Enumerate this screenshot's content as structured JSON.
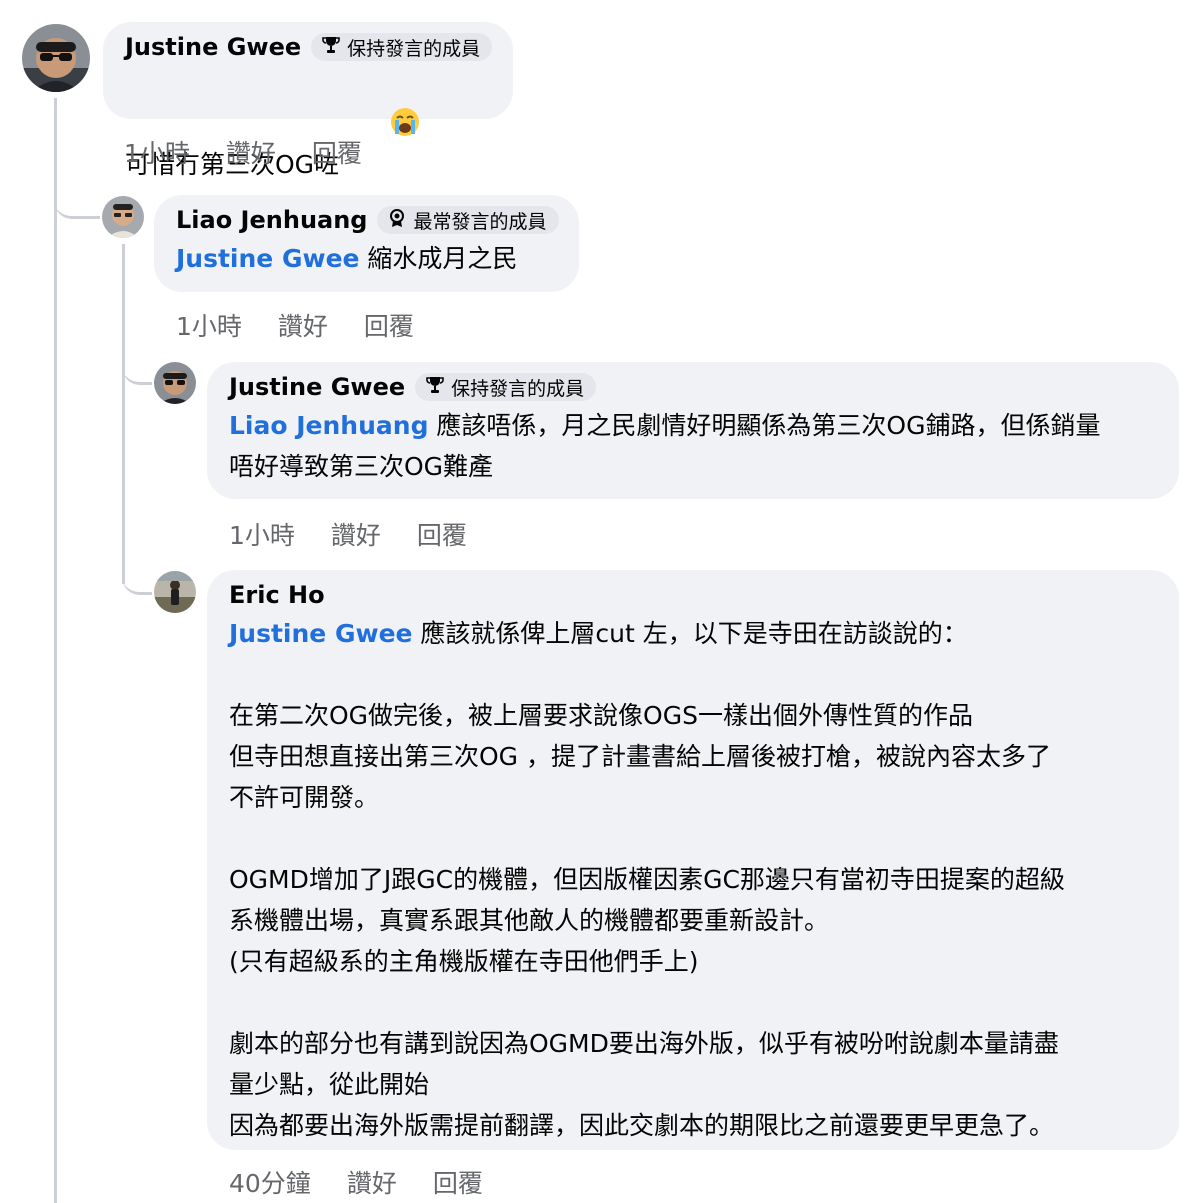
{
  "comments": [
    {
      "author": "Justine Gwee",
      "badge": "保持發言的成員",
      "badge_icon": "trophy-icon",
      "text": "可惜冇第三次OG咗",
      "emoji": "loudly-crying-face",
      "time": "1小時",
      "like": "讚好",
      "reply": "回覆"
    },
    {
      "author": "Liao Jenhuang",
      "badge": "最常發言的成員",
      "badge_icon": "award-ribbon-icon",
      "mention": "Justine Gwee",
      "text": " 縮水成月之民",
      "time": "1小時",
      "like": "讚好",
      "reply": "回覆"
    },
    {
      "author": "Justine Gwee",
      "badge": "保持發言的成員",
      "badge_icon": "trophy-icon",
      "mention": "Liao Jenhuang",
      "text_line1": " 應該唔係，月之民劇情好明顯係為第三次OG鋪路，但係銷量",
      "text_line2": "唔好導致第三次OG難產",
      "time": "1小時",
      "like": "讚好",
      "reply": "回覆"
    },
    {
      "author": "Eric Ho",
      "mention": "Justine Gwee",
      "intro": " 應該就係俾上層cut 左，以下是寺田在訪談說的：",
      "p1": [
        "在第二次OG做完後，被上層要求說像OGS一樣出個外傳性質的作品",
        "但寺田想直接出第三次OG ，提了計畫書給上層後被打槍，被說內容太多了",
        "不許可開發。"
      ],
      "p2": [
        "OGMD增加了J跟GC的機體，但因版權因素GC那邊只有當初寺田提案的超級",
        "系機體出場，真實系跟其他敵人的機體都要重新設計。",
        "(只有超級系的主角機版權在寺田他們手上)"
      ],
      "p3": [
        "劇本的部分也有講到說因為OGMD要出海外版，似乎有被吩咐說劇本量請盡",
        "量少點，從此開始",
        "因為都要出海外版需提前翻譯，因此交劇本的期限比之前還要更早更急了。"
      ],
      "time": "40分鐘",
      "like": "讚好",
      "reply": "回覆"
    }
  ],
  "colors": {
    "bubble": "#f0f2f5",
    "mention": "#216fdb",
    "meta": "#65676b",
    "thread_line": "#ccd0d5"
  }
}
